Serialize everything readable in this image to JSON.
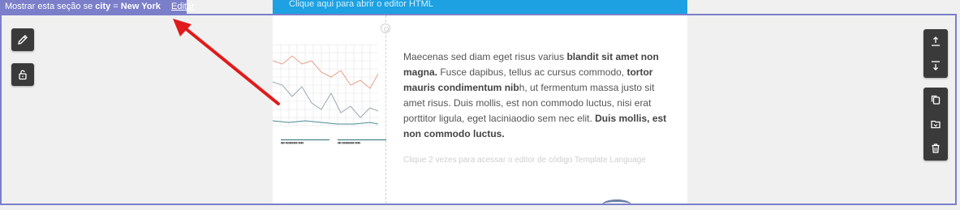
{
  "condition_bar": {
    "prefix": "Mostrar esta seção se ",
    "field": "city",
    "operator": " = ",
    "value": "New York",
    "edit_label": "Editar",
    "color": "#7b7fc9"
  },
  "banner": {
    "text": "Clique aqui para abrir o editor HTML",
    "color": "#1da1e2"
  },
  "content": {
    "paragraph": {
      "p1": "Maecenas sed diam eget risus varius ",
      "b1": "blandit sit amet non magna.",
      "p2": " Fusce dapibus, tellus ac cursus commodo, ",
      "b2": "tortor mauris condimentum nib",
      "p3": "h, ut fermentum massa justo sit amet risus. Duis mollis, est non commodo luctus, nisi erat porttitor ligula, eget laciniaodio sem nec elit. ",
      "b3": "Duis mollis, est non commodo luctus."
    },
    "hint": "Clique 2 vezes para acessar o editor de código Template Language"
  },
  "left_toolbar": {
    "edit_icon": "pencil-icon",
    "unlock_icon": "unlock-icon"
  },
  "right_toolbar": {
    "move_up_icon": "move-up-icon",
    "move_down_icon": "move-down-icon",
    "duplicate_icon": "duplicate-icon",
    "save_icon": "save-block-icon",
    "delete_icon": "trash-icon"
  },
  "annotation": {
    "arrow_color": "#e01b1b"
  }
}
